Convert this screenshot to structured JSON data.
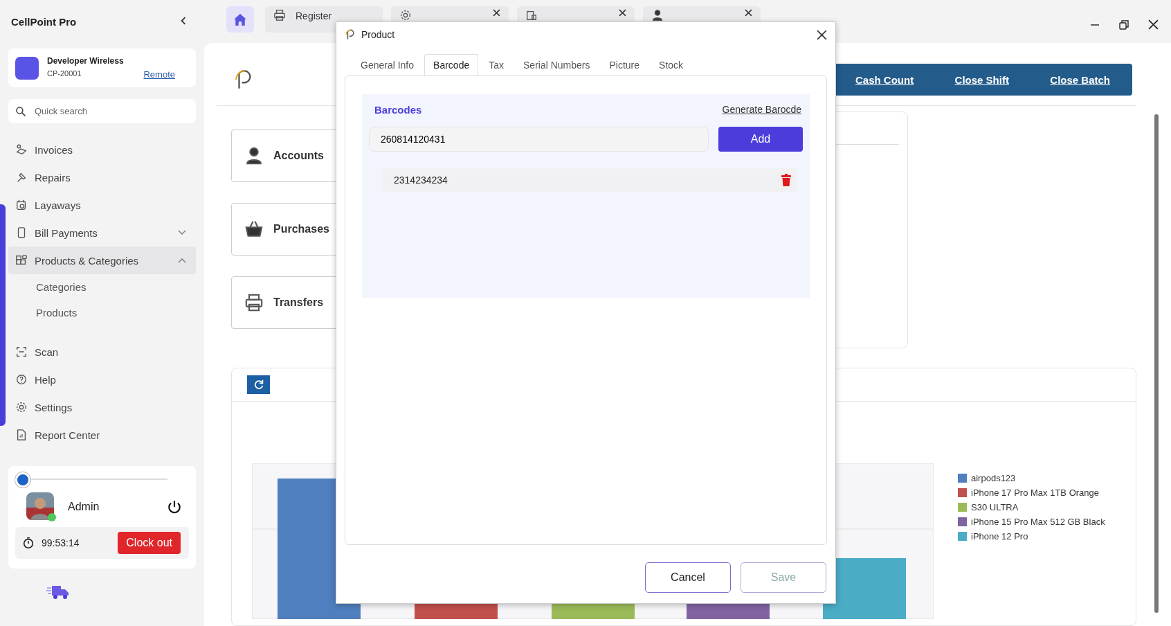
{
  "app": {
    "title": "CellPoint Pro"
  },
  "store": {
    "name": "Developer Wireless",
    "code": "CP-20001",
    "link": "Remote"
  },
  "search": {
    "placeholder": "Quick search"
  },
  "nav": [
    {
      "label": "Invoices",
      "selected": false
    },
    {
      "label": "Repairs",
      "selected": false
    },
    {
      "label": "Layaways",
      "selected": false
    },
    {
      "label": "Bill Payments",
      "selected": false,
      "expanded": false
    },
    {
      "label": "Products & Categories",
      "selected": true,
      "expanded": true,
      "children": [
        {
          "label": "Categories"
        },
        {
          "label": "Products"
        }
      ]
    },
    {
      "label": "Scan",
      "selected": false
    },
    {
      "label": "Help",
      "selected": false
    },
    {
      "label": "Settings",
      "selected": false
    },
    {
      "label": "Report Center",
      "selected": false
    }
  ],
  "user": {
    "name": "Admin",
    "online": true,
    "timer": "99:53:14",
    "clock_button": "Clock out",
    "slider": {
      "level": 0
    }
  },
  "top_tabs": [
    {
      "label": "Register"
    }
  ],
  "home_cards": [
    {
      "label": "Accounts"
    },
    {
      "label": "Purchases"
    },
    {
      "label": "Transfers"
    }
  ],
  "actions": [
    "Cash Count",
    "Close Shift",
    "Close Batch"
  ],
  "legend": [
    {
      "label": "airpods123",
      "color": "#4f7fbf"
    },
    {
      "label": "iPhone 17 Pro Max 1TB Orange",
      "color": "#c0504d"
    },
    {
      "label": "S30 ULTRA",
      "color": "#9bbb59"
    },
    {
      "label": "iPhone 15 Pro Max 512 GB Black",
      "color": "#8064a2"
    },
    {
      "label": "iPhone 12 Pro",
      "color": "#4bacc6"
    }
  ],
  "dialog": {
    "title": "Product",
    "tabs": [
      {
        "label": "General Info",
        "selected": false
      },
      {
        "label": "Barcode",
        "selected": true
      },
      {
        "label": "Tax",
        "selected": false
      },
      {
        "label": "Serial Numbers",
        "selected": false
      },
      {
        "label": "Picture",
        "selected": false
      },
      {
        "label": "Stock",
        "selected": false
      }
    ],
    "section_title": "Barcodes",
    "generate_link": "Generate Barocde",
    "barcode_input": {
      "value": "260814120431"
    },
    "add_button": "Add",
    "barcodes": [
      "2314234234"
    ],
    "buttons": [
      {
        "label": "Cancel",
        "disabled": false
      },
      {
        "label": "Save",
        "disabled": true
      }
    ]
  }
}
